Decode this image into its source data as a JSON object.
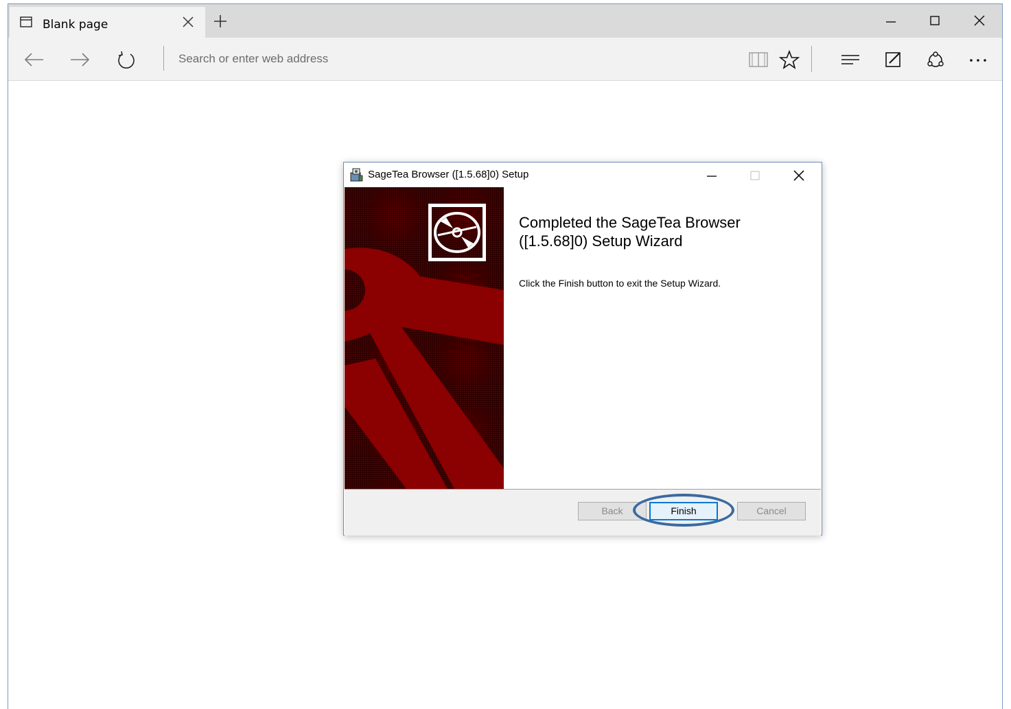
{
  "browser": {
    "tab": {
      "title": "Blank page"
    },
    "address_bar": {
      "placeholder": "Search or enter web address"
    },
    "icons": [
      "page-icon",
      "close-icon",
      "plus-icon",
      "minimize-icon",
      "maximize-icon",
      "close-icon",
      "back-arrow-icon",
      "forward-arrow-icon",
      "refresh-icon",
      "reading-view-icon",
      "star-icon",
      "hub-icon",
      "web-note-icon",
      "share-icon",
      "more-icon"
    ]
  },
  "dialog": {
    "title": "SageTea Browser ([1.5.68]0) Setup",
    "heading": "Completed the SageTea Browser ([1.5.68]0) Setup Wizard",
    "body": "Click the Finish button to exit the Setup Wizard.",
    "buttons": {
      "back": "Back",
      "finish": "Finish",
      "cancel": "Cancel"
    },
    "colors": {
      "banner_dark": "#3a0000",
      "banner_red": "#8b0000",
      "focus": "#0078d7",
      "annotation": "#3a6aa0"
    }
  }
}
